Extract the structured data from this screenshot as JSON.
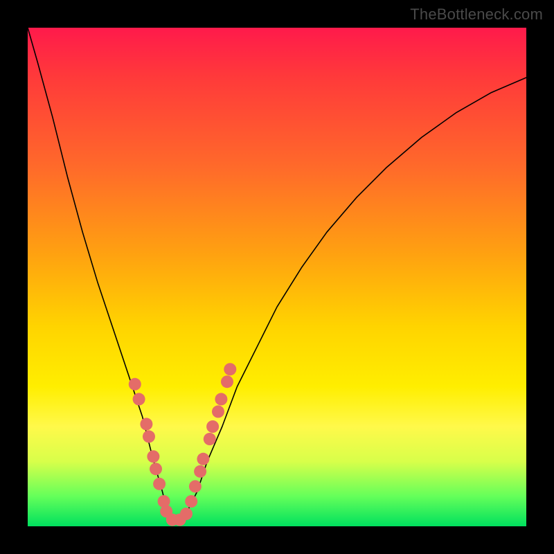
{
  "watermark": "TheBottleneck.com",
  "chart_data": {
    "type": "line",
    "title": "",
    "xlabel": "",
    "ylabel": "",
    "xlim": [
      0,
      100
    ],
    "ylim": [
      0,
      100
    ],
    "legend": false,
    "grid": false,
    "background_gradient_stops": [
      {
        "pos": 0,
        "color": "#ff1a4b"
      },
      {
        "pos": 10,
        "color": "#ff3a3a"
      },
      {
        "pos": 28,
        "color": "#ff6a2a"
      },
      {
        "pos": 45,
        "color": "#ffa011"
      },
      {
        "pos": 60,
        "color": "#ffd400"
      },
      {
        "pos": 72,
        "color": "#ffee00"
      },
      {
        "pos": 80,
        "color": "#fff94a"
      },
      {
        "pos": 87,
        "color": "#d8ff4a"
      },
      {
        "pos": 94,
        "color": "#64ff5a"
      },
      {
        "pos": 100,
        "color": "#00e05e"
      }
    ],
    "series": [
      {
        "name": "bottleneck-curve",
        "description": "V-shaped curve; y = 100 is top of plot (red), y = 0 is bottom (green). Minimum near x ≈ 28–30.",
        "x": [
          0,
          2,
          5,
          8,
          11,
          14,
          17,
          20,
          23,
          25,
          27,
          28,
          29,
          30,
          32,
          34,
          36,
          39,
          42,
          46,
          50,
          55,
          60,
          66,
          72,
          79,
          86,
          93,
          100
        ],
        "y": [
          100,
          93,
          82,
          70,
          59,
          49,
          40,
          31,
          22,
          14,
          7,
          3,
          1,
          1,
          3,
          7,
          13,
          20,
          28,
          36,
          44,
          52,
          59,
          66,
          72,
          78,
          83,
          87,
          90
        ]
      }
    ],
    "markers": {
      "name": "highlight-dots",
      "color": "#e46c68",
      "radius_px": 9,
      "points": [
        {
          "x": 21.5,
          "y": 28.5
        },
        {
          "x": 22.3,
          "y": 25.5
        },
        {
          "x": 23.8,
          "y": 20.5
        },
        {
          "x": 24.3,
          "y": 18.0
        },
        {
          "x": 25.2,
          "y": 14.0
        },
        {
          "x": 25.7,
          "y": 11.5
        },
        {
          "x": 26.4,
          "y": 8.5
        },
        {
          "x": 27.3,
          "y": 5.0
        },
        {
          "x": 27.8,
          "y": 3.0
        },
        {
          "x": 29.0,
          "y": 1.3
        },
        {
          "x": 30.5,
          "y": 1.3
        },
        {
          "x": 31.8,
          "y": 2.5
        },
        {
          "x": 32.8,
          "y": 5.0
        },
        {
          "x": 33.6,
          "y": 8.0
        },
        {
          "x": 34.6,
          "y": 11.0
        },
        {
          "x": 35.2,
          "y": 13.5
        },
        {
          "x": 36.5,
          "y": 17.5
        },
        {
          "x": 37.1,
          "y": 20.0
        },
        {
          "x": 38.2,
          "y": 23.0
        },
        {
          "x": 38.8,
          "y": 25.5
        },
        {
          "x": 40.0,
          "y": 29.0
        },
        {
          "x": 40.6,
          "y": 31.5
        }
      ]
    }
  }
}
